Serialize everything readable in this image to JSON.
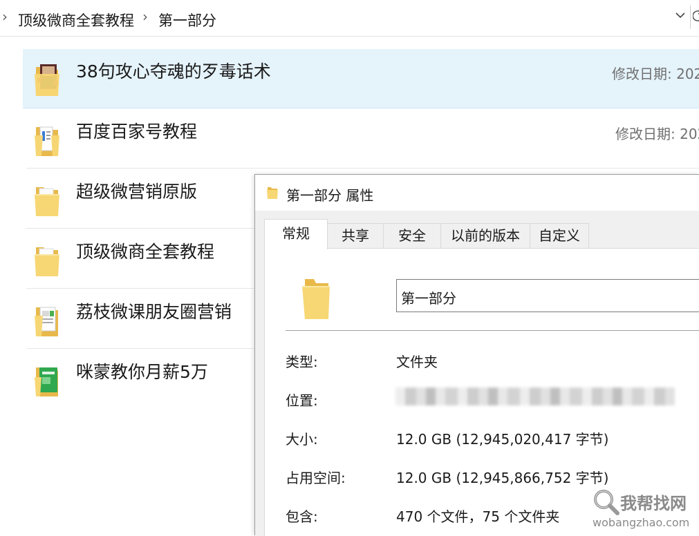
{
  "breadcrumb": {
    "segments": [
      "顶级微商全套教程",
      "第一部分"
    ]
  },
  "files": [
    {
      "name": "38句攻心夺魂的歹毒话术",
      "meta": "修改日期: 202",
      "selected": true,
      "icon": "photo-folder-icon"
    },
    {
      "name": "百度百家号教程",
      "meta": "修改日期: 202",
      "selected": false,
      "icon": "document-folder-icon"
    },
    {
      "name": "超级微营销原版",
      "meta": "",
      "selected": false,
      "icon": "folder-icon"
    },
    {
      "name": "顶级微商全套教程",
      "meta": "",
      "selected": false,
      "icon": "folder-icon"
    },
    {
      "name": "荔枝微课朋友圈营销",
      "meta": "",
      "selected": false,
      "icon": "document-folder-icon"
    },
    {
      "name": "咪蒙教你月薪5万",
      "meta": "",
      "selected": false,
      "icon": "green-folder-icon"
    }
  ],
  "dialog": {
    "title": "第一部分 属性",
    "tabs": [
      "常规",
      "共享",
      "安全",
      "以前的版本",
      "自定义"
    ],
    "active_tab": "常规",
    "folder_name": "第一部分",
    "properties": [
      {
        "label": "类型:",
        "value": "文件夹"
      },
      {
        "label": "位置:",
        "value": ""
      },
      {
        "label": "大小:",
        "value": "12.0 GB (12,945,020,417 字节)"
      },
      {
        "label": "占用空间:",
        "value": "12.0 GB (12,945,866,752 字节)"
      },
      {
        "label": "包含:",
        "value": "470 个文件，75 个文件夹"
      }
    ]
  },
  "watermark": {
    "text": "我帮找网",
    "url": "wobangzhao.com"
  },
  "colors": {
    "selected_row": "#e5f3fb",
    "folder_yellow": "#f7d774",
    "folder_dark": "#e8b94a",
    "dialog_bg": "#f0f0f0"
  }
}
